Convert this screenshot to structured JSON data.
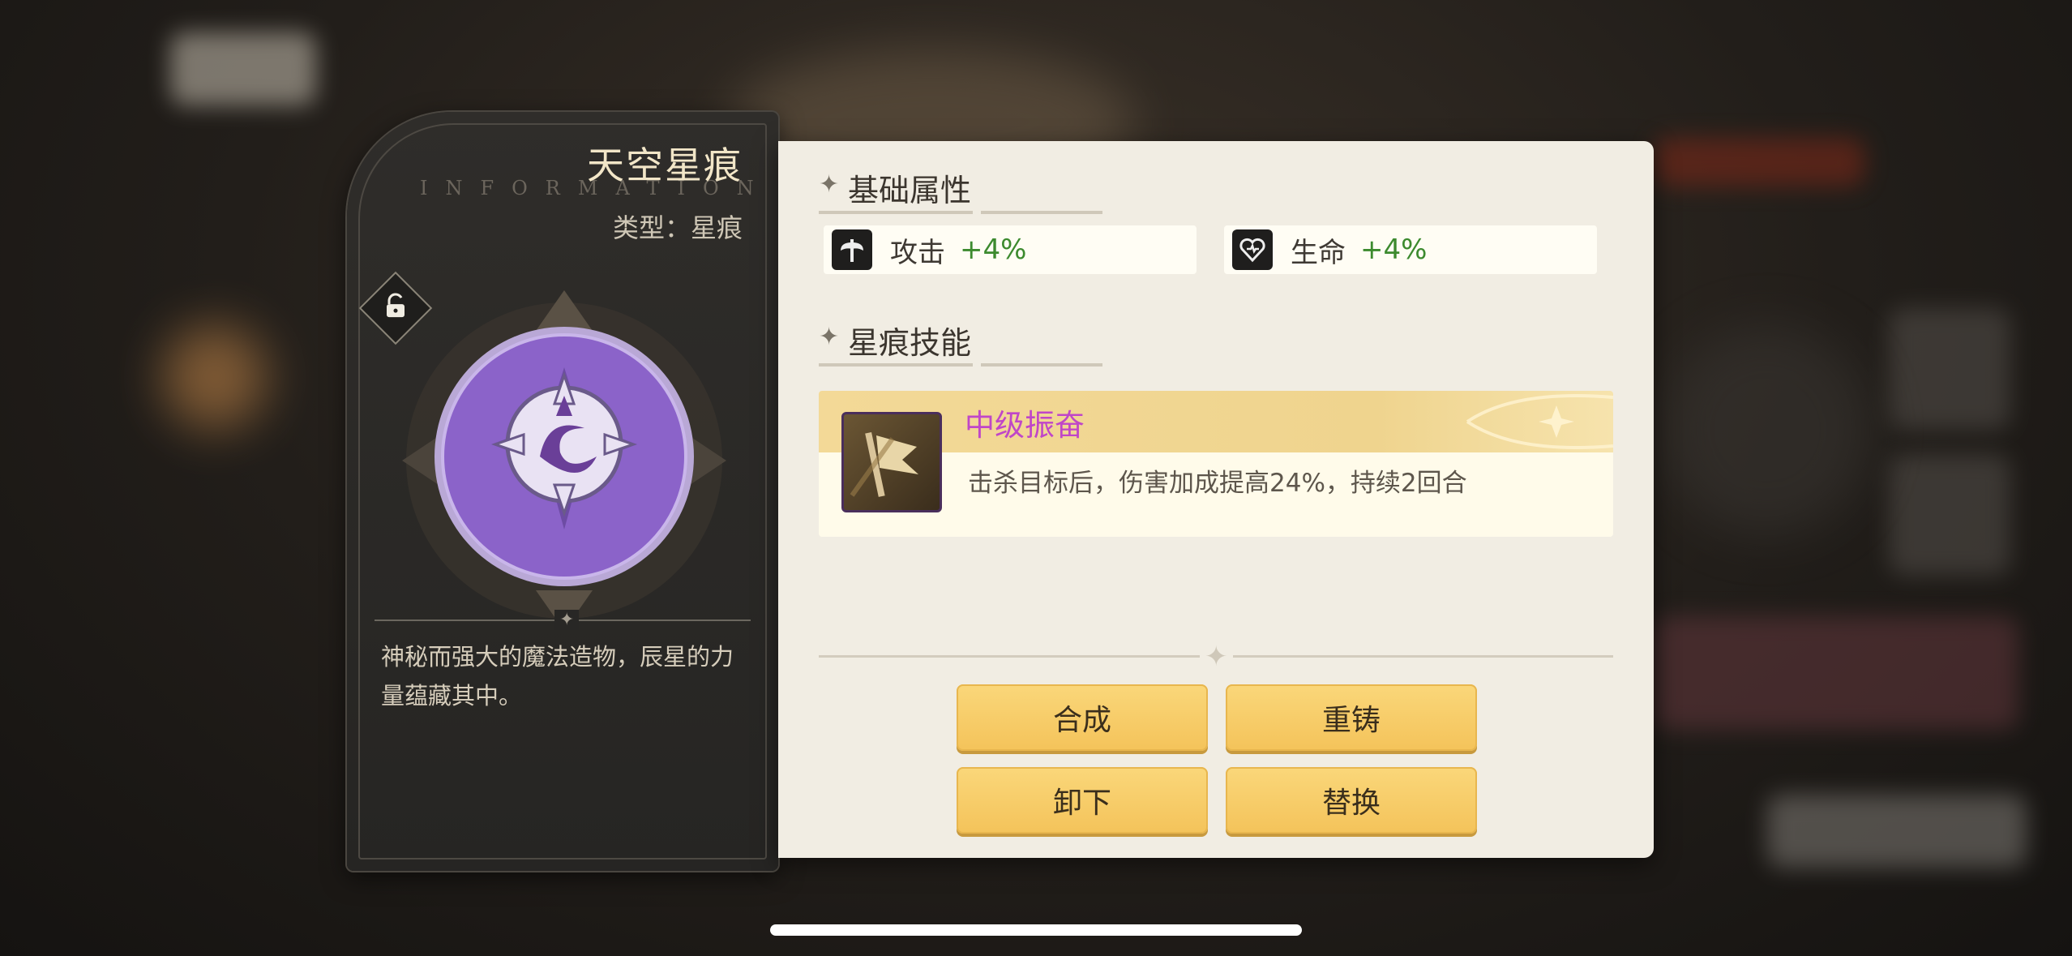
{
  "card": {
    "title": "天空星痕",
    "watermark": "INFORMATION",
    "type_label": "类型：星痕",
    "description": "神秘而强大的魔法造物，辰星的力量蕴藏其中。"
  },
  "attributes": {
    "title": "基础属性",
    "items": [
      {
        "label": "攻击",
        "value": "+4%",
        "icon": "axe-icon"
      },
      {
        "label": "生命",
        "value": "+4%",
        "icon": "heart-icon"
      }
    ]
  },
  "skill": {
    "title": "星痕技能",
    "name": "中级振奋",
    "description": "击杀目标后，伤害加成提高24%，持续2回合",
    "icon": "banner-icon"
  },
  "buttons": {
    "combine": "合成",
    "recast": "重铸",
    "unequip": "卸下",
    "replace": "替换"
  },
  "colors": {
    "accent_gold": "#f4c35a",
    "skill_name": "#c046c8",
    "stat_value": "#3c8a2e",
    "emblem_purple": "#8b63c9"
  }
}
